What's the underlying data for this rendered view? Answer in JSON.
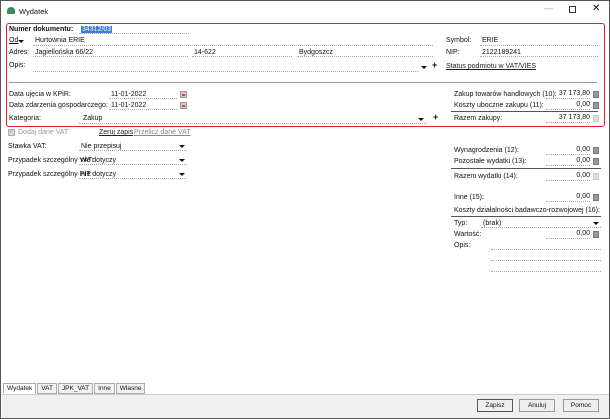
{
  "window": {
    "title": "Wydatek"
  },
  "header": {
    "doc_number_label": "Numer dokumentu:",
    "doc_number": "34312/03",
    "from_label": "Od",
    "from_value": "Hurtownia ERIE",
    "address_label": "Adres:",
    "street": "Jagiellońska  66/22",
    "postal": "14-622",
    "city": "Bydgoszcz",
    "desc_label": "Opis:",
    "symbol_label": "Symbol:",
    "symbol": "ERIE",
    "nip_label": "NIP:",
    "nip": "2122189241",
    "status_link": "Status podmiotu w VAT/VIES"
  },
  "dates": {
    "kpir_label": "Data ujęcia w KPiR:",
    "kpir": "11-01-2022",
    "event_label": "Data zdarzenia gospodarczego:",
    "event": "11-01-2022",
    "category_label": "Kategoria:",
    "category": "Zakup"
  },
  "purchase": {
    "goods_label": "Zakup towarów handlowych (10):",
    "goods": "37 173,80",
    "side_label": "Koszty uboczne zakupu (11):",
    "side": "0,00",
    "total_label": "Razem zakupy:",
    "total": "37 173,80"
  },
  "vat": {
    "add_vat": "Dodaj dane VAT",
    "add_vat_checked": true,
    "reset_link": "Zeruj zapis",
    "recalc_link": "Przelicz dane VAT",
    "rate_label": "Stawka VAT:",
    "rate": "Nie przepisuj",
    "special_vat_label": "Przypadek szczególny VAT:",
    "special_vat": "nie dotyczy",
    "special_pit_label": "Przypadek szczególny PIT:",
    "special_pit": "nie dotyczy"
  },
  "expenses": {
    "salary_label": "Wynagrodzenia (12):",
    "salary": "0,00",
    "other_label": "Pozostałe wydatki (13):",
    "other": "0,00",
    "total_label": "Razem wydatki (14):",
    "total": "0,00",
    "misc_label": "Inne (15):",
    "misc": "0,00",
    "rd_label": "Koszty działalności badawczo-rozwojowej (16):",
    "type_label": "Typ:",
    "type": "(brak)",
    "value_label": "Wartość:",
    "value": "0,00",
    "desc_label": "Opis:"
  },
  "tabs": [
    "Wydatek",
    "VAT",
    "JPK_VAT",
    "Inne",
    "Własne"
  ],
  "buttons": {
    "save": "Zapisz",
    "cancel": "Anuluj",
    "help": "Pomoc"
  }
}
